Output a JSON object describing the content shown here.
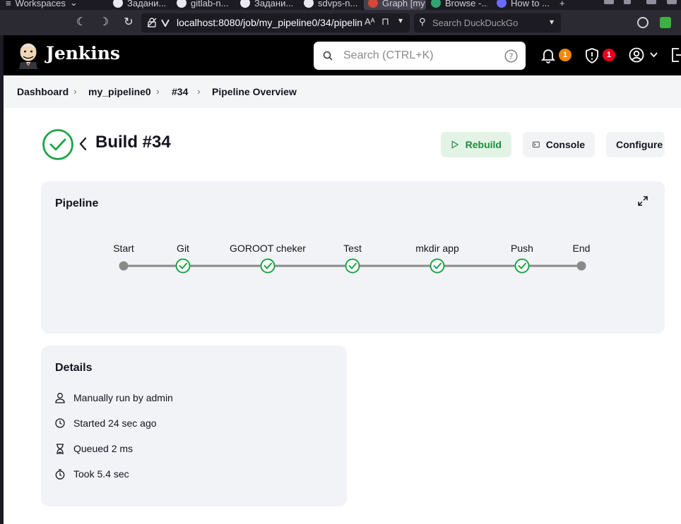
{
  "browser": {
    "tabs": [
      {
        "label": "Workspaces"
      },
      {
        "label": "Задани..."
      },
      {
        "label": "gitlab-n..."
      },
      {
        "label": "Задани..."
      },
      {
        "label": "sdvps-n..."
      },
      {
        "label": "Graph [my"
      },
      {
        "label": "Browse -..."
      },
      {
        "label": "How to ..."
      }
    ],
    "url": "localhost:8080/job/my_pipeline0/34/pipelin",
    "search_placeholder": "Search DuckDuckGo"
  },
  "jenkins": {
    "title": "Jenkins",
    "search_placeholder": "Search (CTRL+K)",
    "notifications_count": "1",
    "security_count": "1",
    "colors": {
      "notification": "#f08a00",
      "security": "#e6001f",
      "success": "#1ea446"
    }
  },
  "breadcrumbs": [
    "Dashboard",
    "my_pipeline0",
    "#34",
    "Pipeline Overview"
  ],
  "build": {
    "title": "Build #34",
    "status": "success",
    "buttons": {
      "rebuild": "Rebuild",
      "console": "Console",
      "configure": "Configure"
    }
  },
  "pipeline": {
    "title": "Pipeline",
    "stages": [
      {
        "name": "Start",
        "status": "none"
      },
      {
        "name": "Git",
        "status": "success"
      },
      {
        "name": "GOROOT cheker",
        "status": "success"
      },
      {
        "name": "Test",
        "status": "success"
      },
      {
        "name": "mkdir app",
        "status": "success"
      },
      {
        "name": "Push",
        "status": "success"
      },
      {
        "name": "End",
        "status": "none"
      }
    ]
  },
  "details": {
    "title": "Details",
    "rows": [
      {
        "icon": "user-icon",
        "text": "Manually run by admin"
      },
      {
        "icon": "clock-icon",
        "text": "Started 24 sec ago"
      },
      {
        "icon": "hourglass-icon",
        "text": "Queued 2 ms"
      },
      {
        "icon": "timer-icon",
        "text": "Took 5.4 sec"
      }
    ]
  }
}
